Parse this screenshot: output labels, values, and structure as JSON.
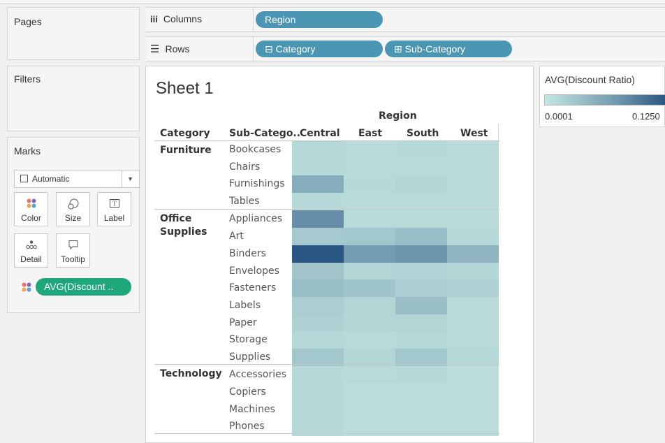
{
  "pages_panel": {
    "title": "Pages"
  },
  "filters_panel": {
    "title": "Filters"
  },
  "shelves": {
    "columns": {
      "label": "Columns",
      "pills": [
        "Region"
      ]
    },
    "rows": {
      "label": "Rows",
      "pills": [
        "⊟ Category",
        "⊞ Sub-Category"
      ]
    }
  },
  "marks": {
    "title": "Marks",
    "mark_type": "Automatic",
    "buttons": {
      "color": "Color",
      "size": "Size",
      "label": "Label",
      "detail": "Detail",
      "tooltip": "Tooltip"
    },
    "color_field": "AVG(Discount .."
  },
  "sheet": {
    "title": "Sheet 1",
    "region_header": "Region",
    "category_header": "Category",
    "subcategory_header": "Sub-Catego..",
    "regions": [
      "Central",
      "East",
      "South",
      "West"
    ],
    "groups": [
      {
        "category": "Furniture",
        "subcategories": [
          "Bookcases",
          "Chairs",
          "Furnishings",
          "Tables"
        ]
      },
      {
        "category": "Office\nSupplies",
        "subcategories": [
          "Appliances",
          "Art",
          "Binders",
          "Envelopes",
          "Fasteners",
          "Labels",
          "Paper",
          "Storage",
          "Supplies"
        ]
      },
      {
        "category": "Technology",
        "subcategories": [
          "Accessories",
          "Copiers",
          "Machines",
          "Phones"
        ]
      }
    ]
  },
  "legend": {
    "title": "AVG(Discount Ratio)",
    "min_label": "0.0001",
    "max_label": "0.1250",
    "color_low": "#c4e6e1",
    "color_high": "#2a5783"
  },
  "heatmap": {
    "rows": [
      "Bookcases",
      "Chairs",
      "Furnishings",
      "Tables",
      "Appliances",
      "Art",
      "Binders",
      "Envelopes",
      "Fasteners",
      "Labels",
      "Paper",
      "Storage",
      "Supplies",
      "Accessories",
      "Copiers",
      "Machines",
      "Phones"
    ],
    "cols": [
      "Central",
      "East",
      "South",
      "West"
    ],
    "intensity": [
      [
        0.1,
        0.08,
        0.09,
        0.08
      ],
      [
        0.1,
        0.08,
        0.08,
        0.08
      ],
      [
        0.4,
        0.09,
        0.12,
        0.08
      ],
      [
        0.09,
        0.08,
        0.08,
        0.08
      ],
      [
        0.62,
        0.08,
        0.08,
        0.08
      ],
      [
        0.2,
        0.22,
        0.27,
        0.1
      ],
      [
        1.0,
        0.52,
        0.56,
        0.34
      ],
      [
        0.23,
        0.12,
        0.13,
        0.11
      ],
      [
        0.29,
        0.24,
        0.16,
        0.14
      ],
      [
        0.17,
        0.12,
        0.27,
        0.08
      ],
      [
        0.14,
        0.12,
        0.12,
        0.08
      ],
      [
        0.1,
        0.08,
        0.1,
        0.08
      ],
      [
        0.22,
        0.12,
        0.22,
        0.1
      ],
      [
        0.09,
        0.08,
        0.09,
        0.06
      ],
      [
        0.09,
        0.06,
        0.06,
        0.06
      ],
      [
        0.09,
        0.06,
        0.06,
        0.06
      ],
      [
        0.09,
        0.06,
        0.06,
        0.06
      ]
    ]
  }
}
